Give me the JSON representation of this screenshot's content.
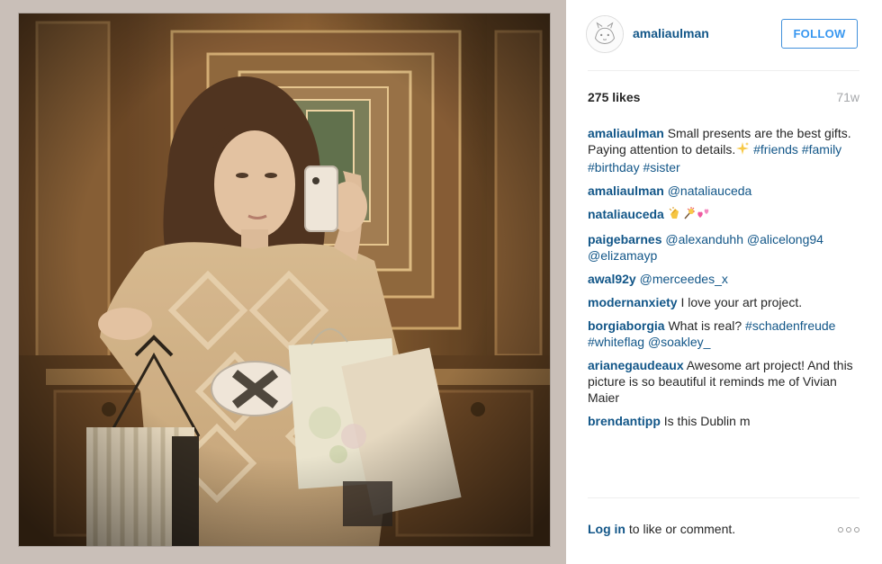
{
  "post": {
    "author": "amaliaulman",
    "follow_label": "FOLLOW",
    "likes": "275 likes",
    "time_ago": "71w"
  },
  "comments": [
    {
      "user": "amaliaulman",
      "text_a": " Small presents are the best gifts. Paying attention to details.",
      "emoji_a": "sparkles",
      "tags": [
        "#friends",
        "#family",
        "#birthday",
        "#sister"
      ]
    },
    {
      "user": "amaliaulman",
      "mention": "@nataliauceda"
    },
    {
      "user": "nataliauceda",
      "emojis": [
        "clapping-hands",
        "sparkler",
        "two-hearts"
      ]
    },
    {
      "user": "paigebarnes",
      "mentions": [
        "@alexanduhh",
        "@alicelong94",
        "@elizamayp"
      ]
    },
    {
      "user": "awal92y",
      "mention": "@merceedes_x"
    },
    {
      "user": "modernanxiety",
      "text": " I love your art project."
    },
    {
      "user": "borgiaborgia",
      "text_a": " What is real? ",
      "tags": [
        "#schadenfreude",
        "#whiteflag"
      ],
      "mention": "@soakley_"
    },
    {
      "user": "arianegaudeaux",
      "text": " Awesome art project! And this picture is so beautiful it reminds me of Vivian Maier"
    },
    {
      "user": "brendantipp",
      "text": " Is this Dublin m"
    }
  ],
  "footer": {
    "login_label": "Log in",
    "login_rest": " to like or comment.",
    "more_icon": "ellipsis-icon"
  },
  "colors": {
    "link_blue": "#125688",
    "follow_blue": "#3897f0",
    "text": "#262626",
    "muted": "#a5a7aa"
  }
}
